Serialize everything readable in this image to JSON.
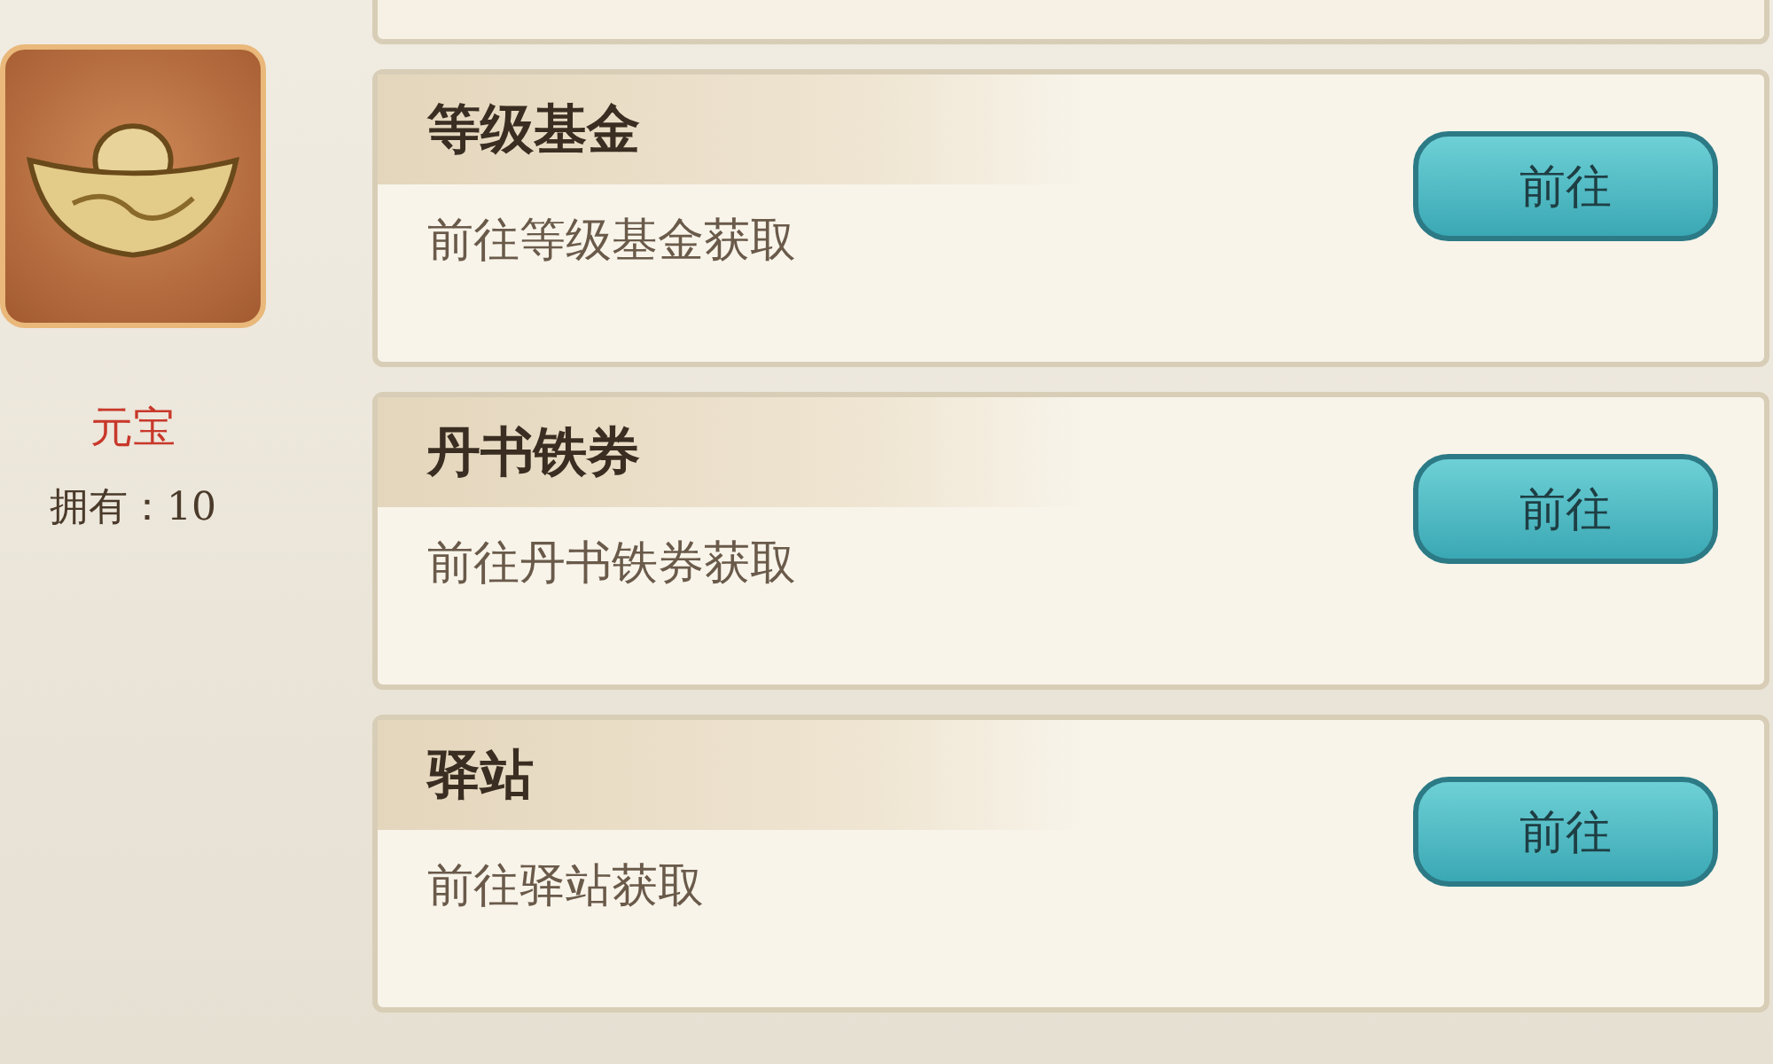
{
  "item": {
    "name": "元宝",
    "owned": "拥有：10"
  },
  "sources": [
    {
      "title": "等级基金",
      "description": "前往等级基金获取",
      "button": "前往"
    },
    {
      "title": "丹书铁券",
      "description": "前往丹书铁券获取",
      "button": "前往"
    },
    {
      "title": "驿站",
      "description": "前往驿站获取",
      "button": "前往"
    }
  ]
}
